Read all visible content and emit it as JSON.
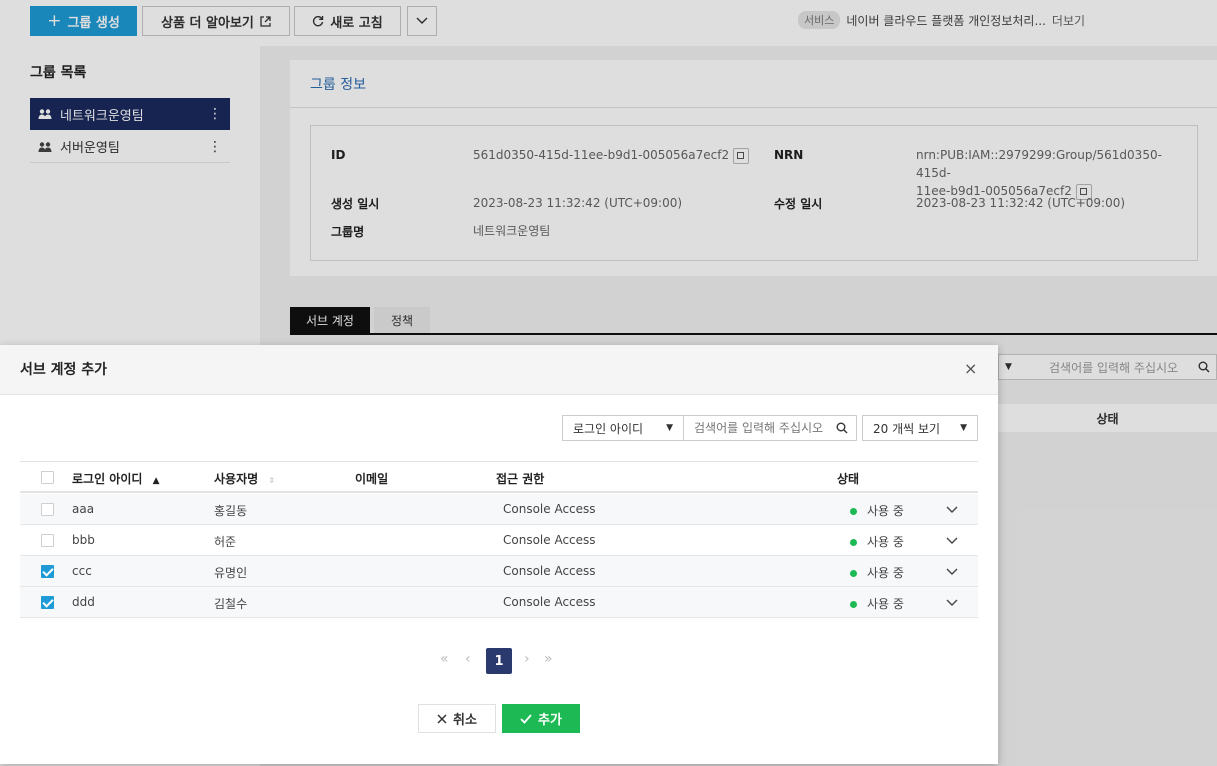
{
  "toolbar": {
    "create_group": "그룹 생성",
    "learn_more": "상품 더 알아보기",
    "refresh": "새로 고침",
    "service_badge": "서비스",
    "service_text": "네이버 클라우드 플랫폼 개인정보처리...",
    "more": "더보기"
  },
  "sidebar": {
    "title": "그룹 목록",
    "items": [
      {
        "label": "네트워크운영팀",
        "active": true
      },
      {
        "label": "서버운영팀",
        "active": false
      }
    ]
  },
  "group_info": {
    "title": "그룹 정보",
    "id_label": "ID",
    "id_value": "561d0350-415d-11ee-b9d1-005056a7ecf2",
    "nrn_label": "NRN",
    "nrn_value_line1": "nrn:PUB:IAM::2979299:Group/561d0350-415d-",
    "nrn_value_line2": "11ee-b9d1-005056a7ecf2",
    "created_label": "생성 일시",
    "created_value": "2023-08-23 11:32:42 (UTC+09:00)",
    "modified_label": "수정 일시",
    "modified_value": "2023-08-23 11:32:42 (UTC+09:00)",
    "name_label": "그룹명",
    "name_value": "네트워크운영팀"
  },
  "tabs": {
    "sub_account": "서브 계정",
    "policy": "정책"
  },
  "background_table": {
    "search_placeholder": "검색어를 입력해 주십시오",
    "status_header": "상태"
  },
  "modal": {
    "title": "서브 계정 추가",
    "close": "×",
    "filter_select": "로그인 아이디",
    "search_placeholder": "검색어를 입력해 주십시오",
    "page_size": "20 개씩 보기",
    "columns": {
      "login_id": "로그인 아이디",
      "user_name": "사용자명",
      "email": "이메일",
      "access": "접근 권한",
      "status": "상태"
    },
    "rows": [
      {
        "login_id": "aaa",
        "user_name": "홍길동",
        "email": "",
        "access": "Console Access",
        "status": "사용 중",
        "checked": false
      },
      {
        "login_id": "bbb",
        "user_name": "허준",
        "email": "",
        "access": "Console Access",
        "status": "사용 중",
        "checked": false
      },
      {
        "login_id": "ccc",
        "user_name": "유명인",
        "email": "",
        "access": "Console Access",
        "status": "사용 중",
        "checked": true
      },
      {
        "login_id": "ddd",
        "user_name": "김철수",
        "email": "",
        "access": "Console Access",
        "status": "사용 중",
        "checked": true
      }
    ],
    "pagination": {
      "current_page": "1"
    },
    "cancel": "취소",
    "add": "추가"
  },
  "colors": {
    "primary": "#1e9bd7",
    "active_nav": "#1b2a5e",
    "success": "#1db954",
    "link_title": "#2b6cb0"
  }
}
